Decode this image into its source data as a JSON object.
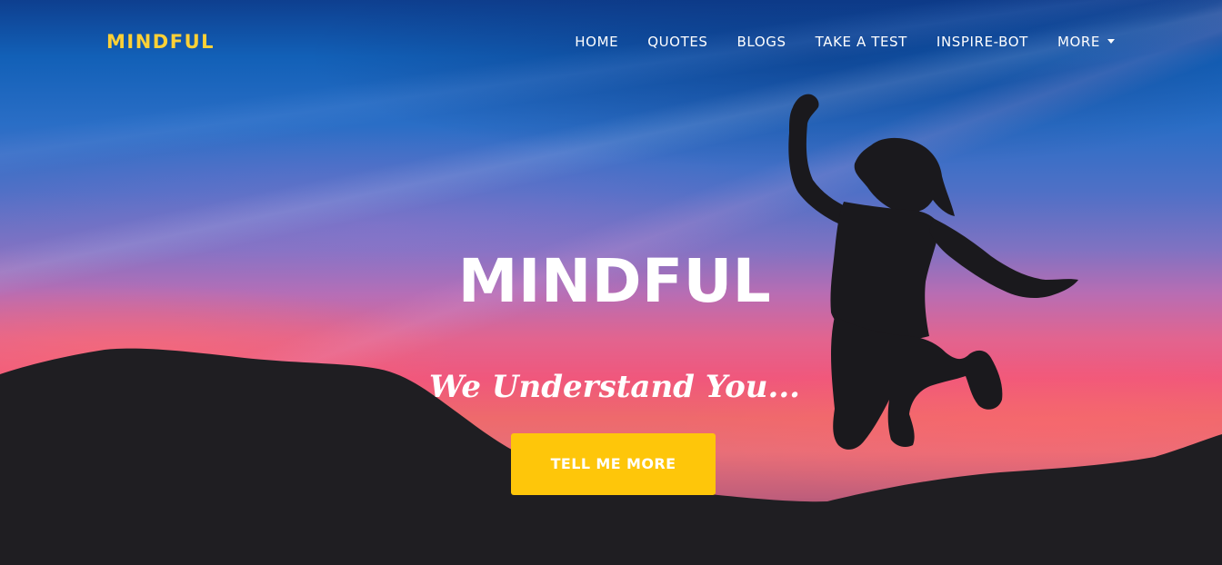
{
  "brand": {
    "name": "MINDFUL",
    "color": "#fed136"
  },
  "nav": {
    "items": [
      {
        "label": "HOME"
      },
      {
        "label": "QUOTES"
      },
      {
        "label": "BLOGS"
      },
      {
        "label": "TAKE A TEST"
      },
      {
        "label": "INSPIRE-BOT"
      },
      {
        "label": "MORE",
        "icon": "caret-down-icon"
      }
    ]
  },
  "hero": {
    "heading": "MINDFUL",
    "subheading": "We Understand You...",
    "cta_label": "TELL ME MORE",
    "cta_color": "#fec60a",
    "background": "sunset-sky-jumping-woman-silhouette"
  }
}
